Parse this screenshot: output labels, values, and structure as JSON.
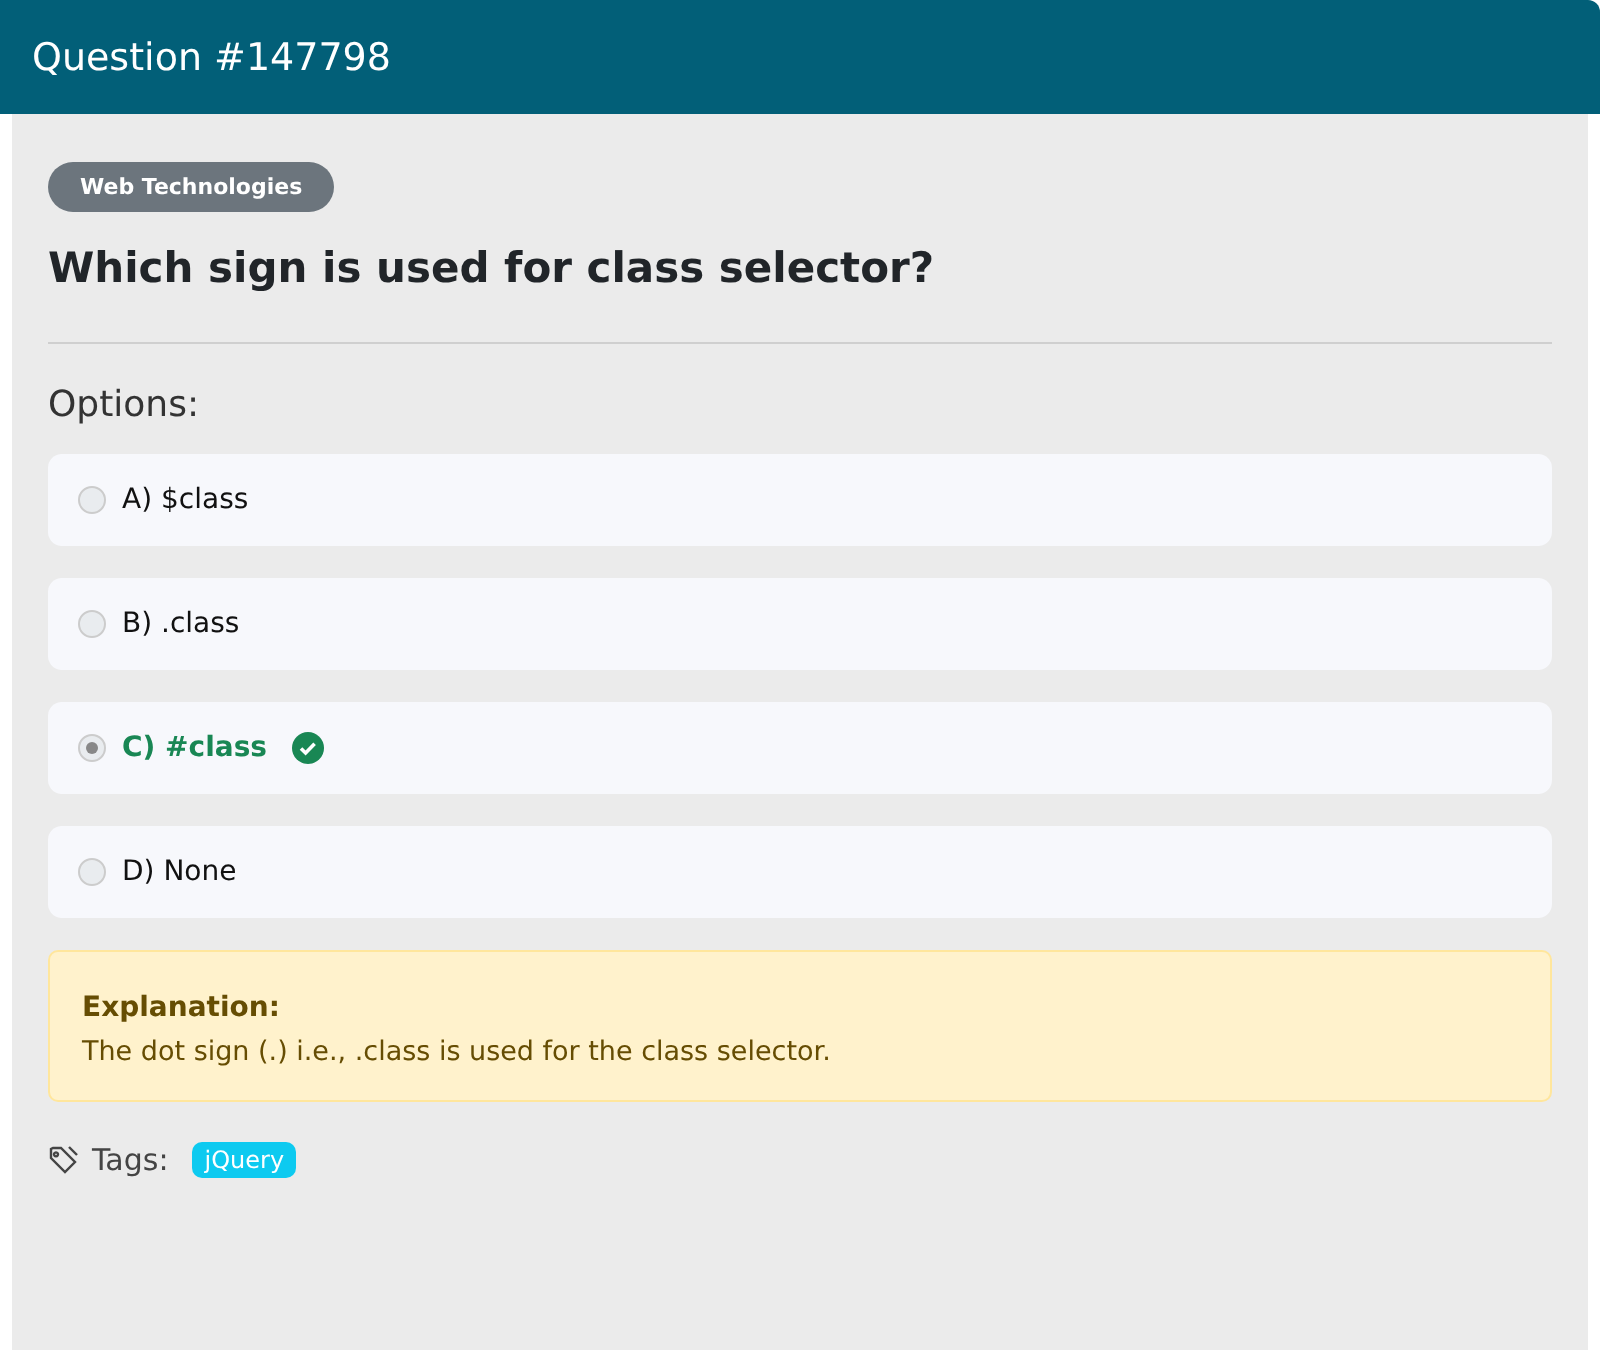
{
  "header": {
    "title": "Question #147798"
  },
  "category": "Web Technologies",
  "question": "Which sign is used for class selector?",
  "options_label": "Options:",
  "options": [
    {
      "label": "A) $class",
      "selected": false,
      "correct": false
    },
    {
      "label": "B) .class",
      "selected": false,
      "correct": false
    },
    {
      "label": "C) #class",
      "selected": true,
      "correct": true
    },
    {
      "label": "D) None",
      "selected": false,
      "correct": false
    }
  ],
  "explanation": {
    "title": "Explanation:",
    "text": "The dot sign (.) i.e., .class is used for the class selector."
  },
  "tags_label": "Tags:",
  "tags": [
    "jQuery"
  ]
}
